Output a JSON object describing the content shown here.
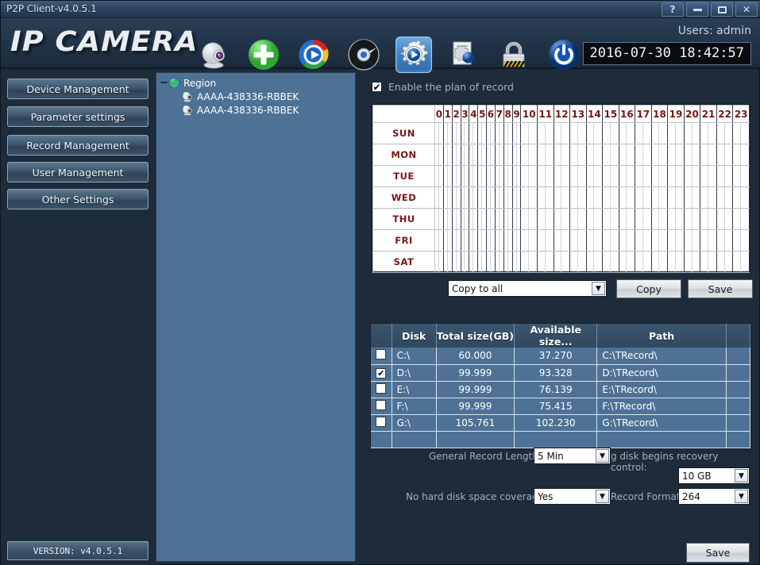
{
  "window": {
    "title": "P2P Client-v4.0.5.1",
    "buttons": [
      {
        "name": "help-button",
        "label": "?"
      },
      {
        "name": "minimize-button",
        "label": ""
      },
      {
        "name": "maximize-button",
        "label": ""
      },
      {
        "name": "close-button",
        "label": "✕"
      }
    ]
  },
  "header": {
    "logo": "IP CAMERA",
    "user_label": "Users: admin",
    "clock": "2016-07-30 18:42:57",
    "toolbar": [
      {
        "name": "camera-icon",
        "label": "camera-icon",
        "active": false
      },
      {
        "name": "add-device-icon",
        "label": "add-device-icon",
        "active": false
      },
      {
        "name": "play-icon",
        "label": "play-icon",
        "active": false
      },
      {
        "name": "ptz-wheel-icon",
        "label": "ptz-wheel-icon",
        "active": false
      },
      {
        "name": "settings-gear-icon",
        "label": "settings-gear-icon",
        "active": true
      },
      {
        "name": "log-settings-icon",
        "label": "log-settings-icon",
        "active": false
      },
      {
        "name": "lock-icon",
        "label": "lock-icon",
        "active": false
      },
      {
        "name": "power-icon",
        "label": "power-icon",
        "active": false
      }
    ]
  },
  "sidebar": {
    "items": [
      {
        "label": "Device Management"
      },
      {
        "label": "Parameter settings"
      },
      {
        "label": "Record Management"
      },
      {
        "label": "User Management"
      },
      {
        "label": "Other Settings"
      }
    ],
    "version": "VERSION: v4.0.5.1"
  },
  "tree": {
    "expander": "−",
    "root": "Region",
    "children": [
      {
        "label": "AAAA-438336-RBBEK"
      },
      {
        "label": "AAAA-438336-RBBEK"
      }
    ]
  },
  "plan": {
    "enable_label": "Enable the plan of record",
    "enable_checked": "✔",
    "hours": [
      "0",
      "1",
      "2",
      "3",
      "4",
      "5",
      "6",
      "7",
      "8",
      "9",
      "10",
      "11",
      "12",
      "13",
      "14",
      "15",
      "16",
      "17",
      "18",
      "19",
      "20",
      "21",
      "22",
      "23"
    ],
    "days": [
      "SUN",
      "MON",
      "TUE",
      "WED",
      "THU",
      "FRI",
      "SAT"
    ],
    "corner": "",
    "copy_select": "Copy to all",
    "copy_button": "Copy",
    "save_button": "Save",
    "arrow": "▼"
  },
  "disks": {
    "columns": [
      "",
      "Disk",
      "Total size(GB)",
      "Available size...",
      "Path",
      ""
    ],
    "rows": [
      {
        "checked": false,
        "check_mark": "",
        "disk": "C:\\",
        "total": "60.000",
        "available": "37.270",
        "path": "C:\\TRecord\\"
      },
      {
        "checked": true,
        "check_mark": "✔",
        "disk": "D:\\",
        "total": "99.999",
        "available": "93.328",
        "path": "D:\\TRecord\\"
      },
      {
        "checked": false,
        "check_mark": "",
        "disk": "E:\\",
        "total": "99.999",
        "available": "76.139",
        "path": "E:\\TRecord\\"
      },
      {
        "checked": false,
        "check_mark": "",
        "disk": "F:\\",
        "total": "99.999",
        "available": "75.415",
        "path": "F:\\TRecord\\"
      },
      {
        "checked": false,
        "check_mark": "",
        "disk": "G:\\",
        "total": "105.761",
        "available": "102.230",
        "path": "G:\\TRecord\\"
      }
    ]
  },
  "options": {
    "record_length_label": "General Record Length:",
    "record_length_value": "5 Min",
    "recovery_label": "g disk begins recovery control:",
    "recovery_value": "10 GB",
    "coverage_label": "No hard disk space coverage:",
    "coverage_value": "Yes",
    "format_label": "Record Format:",
    "format_value": "264",
    "save_button": "Save",
    "arrow": "▼"
  },
  "colors": {
    "accent": "#4e7296",
    "background": "#1d2b3a",
    "header_text": "#7a1515"
  }
}
